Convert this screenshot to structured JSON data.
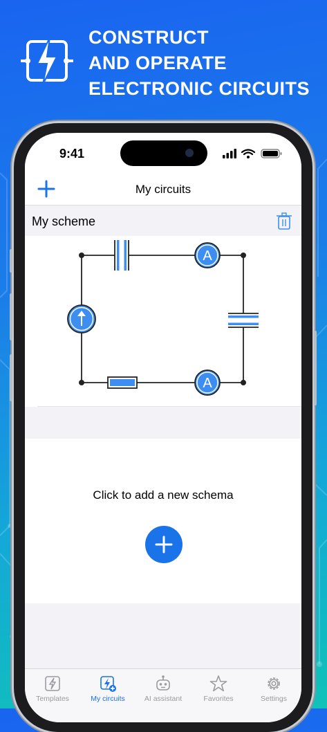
{
  "hero": {
    "lines": [
      "CONSTRUCT",
      "AND OPERATE",
      "ELECTRONIC CIRCUITS"
    ]
  },
  "status_bar": {
    "time": "9:41"
  },
  "navbar": {
    "title": "My circuits"
  },
  "scheme_card": {
    "title": "My scheme"
  },
  "add_schema": {
    "label": "Click to add a new schema"
  },
  "tabs": [
    {
      "label": "Templates",
      "icon": "templates-icon",
      "active": false
    },
    {
      "label": "My circuits",
      "icon": "my-circuits-icon",
      "active": true
    },
    {
      "label": "AI assistant",
      "icon": "ai-assistant-icon",
      "active": false
    },
    {
      "label": "Favorites",
      "icon": "star-icon",
      "active": false
    },
    {
      "label": "Settings",
      "icon": "gear-icon",
      "active": false
    }
  ],
  "circuit": {
    "components": [
      {
        "type": "capacitor",
        "position": "top"
      },
      {
        "type": "ammeter",
        "position": "top-right",
        "label": "A"
      },
      {
        "type": "capacitor",
        "position": "right"
      },
      {
        "type": "ammeter",
        "position": "bottom-right",
        "label": "A"
      },
      {
        "type": "resistor",
        "position": "bottom"
      },
      {
        "type": "current-source",
        "position": "left"
      }
    ]
  },
  "colors": {
    "accent": "#1a73e8",
    "component_fill": "#3d8ef0",
    "background_top": "#1a64f0",
    "background_bottom": "#10c2b8"
  }
}
